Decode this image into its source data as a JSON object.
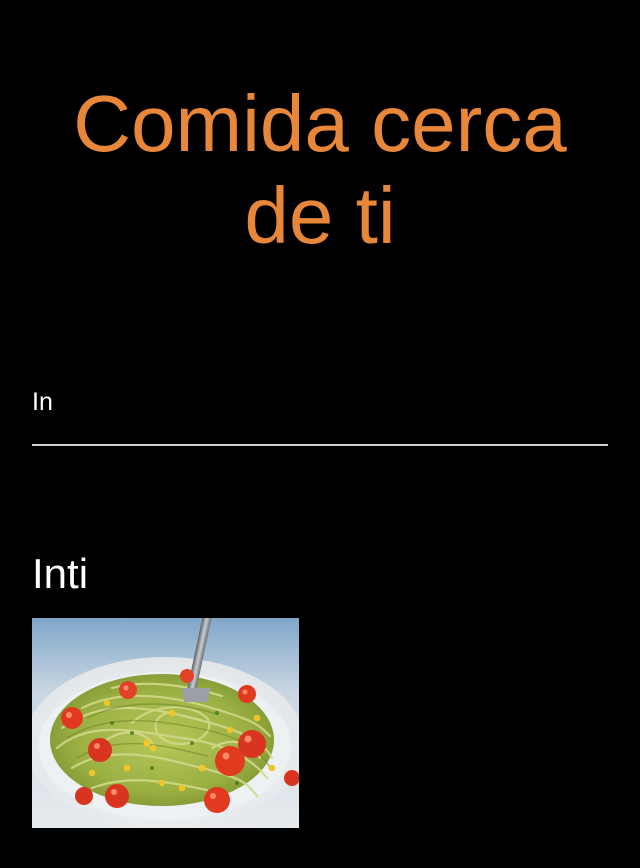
{
  "header": {
    "title_line1": "Comida cerca",
    "title_line2": "de ti"
  },
  "search": {
    "value": "In",
    "placeholder": ""
  },
  "results": [
    {
      "name": "Inti",
      "image": "pasta-dish-photo"
    }
  ],
  "colors": {
    "accent": "#E8873A",
    "background": "#000000",
    "text": "#FFFFFF",
    "underline": "#CFCFCF"
  }
}
